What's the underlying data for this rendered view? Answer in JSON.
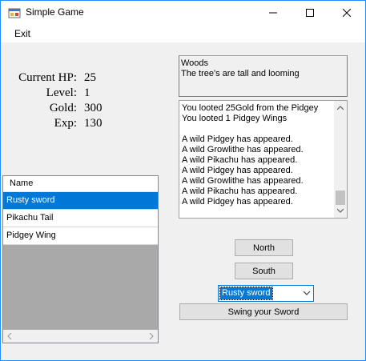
{
  "window": {
    "title": "Simple Game"
  },
  "menu": {
    "exit_label": "Exit"
  },
  "stats": [
    {
      "label": "Current HP:",
      "value": "25"
    },
    {
      "label": "Level:",
      "value": "1"
    },
    {
      "label": "Gold:",
      "value": "300"
    },
    {
      "label": "Exp:",
      "value": "130"
    }
  ],
  "location": {
    "name": "Woods",
    "description": "The tree's are tall and looming"
  },
  "log": {
    "lines": [
      "You looted 25Gold from the Pidgey",
      "You looted 1 Pidgey Wings",
      "",
      "A wild Pidgey has appeared.",
      "A wild Growlithe has appeared.",
      "A wild Pikachu has appeared.",
      "A wild Pidgey has appeared.",
      "A wild Growlithe has appeared.",
      "A wild Pikachu has appeared.",
      "A wild Pidgey has appeared."
    ]
  },
  "inventory": {
    "column_header": "Name",
    "items": [
      "Rusty sword",
      "Pikachu Tail",
      "Pidgey Wing"
    ],
    "selected_index": 0
  },
  "controls": {
    "north_label": "North",
    "south_label": "South",
    "weapon_selected": "Rusty sword",
    "swing_label": "Swing your Sword"
  },
  "colors": {
    "selection": "#0078d7",
    "window_bg": "#f0f0f0",
    "list_bg": "#a9a9a9"
  },
  "icons": [
    "app-icon",
    "minimize-icon",
    "maximize-icon",
    "close-icon",
    "scroll-up-icon",
    "scroll-down-icon",
    "scroll-left-icon",
    "scroll-right-icon",
    "dropdown-arrow-icon"
  ]
}
